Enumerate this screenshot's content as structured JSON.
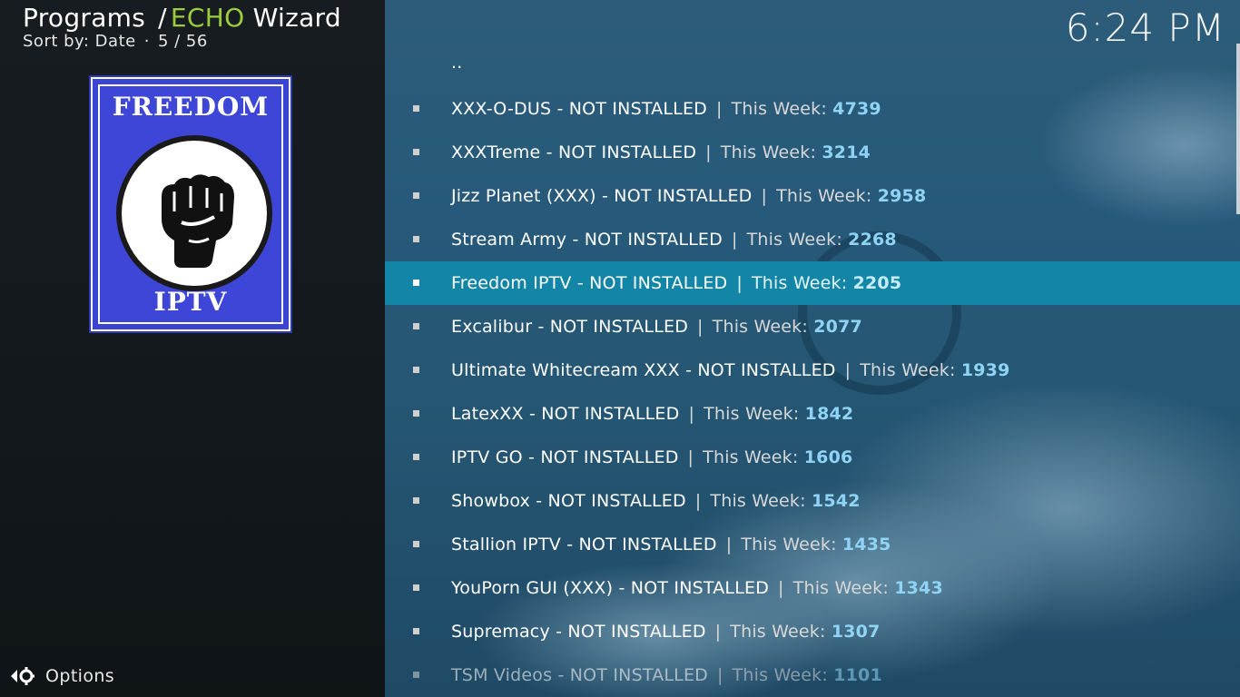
{
  "header": {
    "section": "Programs",
    "separator": "/",
    "addon_accent": "ECHO",
    "addon_rest": "Wizard",
    "sort_label": "Sort by: Date",
    "sort_dot": "·",
    "position": "5 / 56"
  },
  "clock": "6:24 PM",
  "thumbnail": {
    "top_text": "FREEDOM",
    "bottom_text": "IPTV"
  },
  "options": {
    "label": "Options"
  },
  "list": {
    "parent": "..",
    "separator": "|",
    "week_label": "This Week:",
    "items": [
      {
        "name": "XXX-O-DUS - NOT INSTALLED",
        "count": "4739"
      },
      {
        "name": "XXXTreme - NOT INSTALLED",
        "count": "3214"
      },
      {
        "name": "Jizz Planet (XXX) - NOT INSTALLED",
        "count": "2958"
      },
      {
        "name": "Stream Army - NOT INSTALLED",
        "count": "2268"
      },
      {
        "name": "Freedom IPTV - NOT INSTALLED",
        "count": "2205"
      },
      {
        "name": "Excalibur - NOT INSTALLED",
        "count": "2077"
      },
      {
        "name": "Ultimate Whitecream XXX - NOT INSTALLED",
        "count": "1939"
      },
      {
        "name": "LatexXX - NOT INSTALLED",
        "count": "1842"
      },
      {
        "name": "IPTV GO - NOT INSTALLED",
        "count": "1606"
      },
      {
        "name": "Showbox - NOT INSTALLED",
        "count": "1542"
      },
      {
        "name": "Stallion IPTV - NOT INSTALLED",
        "count": "1435"
      },
      {
        "name": "YouPorn GUI (XXX) - NOT INSTALLED",
        "count": "1343"
      },
      {
        "name": "Supremacy - NOT INSTALLED",
        "count": "1307"
      },
      {
        "name": "TSM Videos - NOT INSTALLED",
        "count": "1101"
      }
    ]
  },
  "colors": {
    "accent": "#9ccd3b",
    "selection": "#1386a8",
    "count": "#8fd3f5",
    "thumbnail_bg": "#3d46d6"
  }
}
